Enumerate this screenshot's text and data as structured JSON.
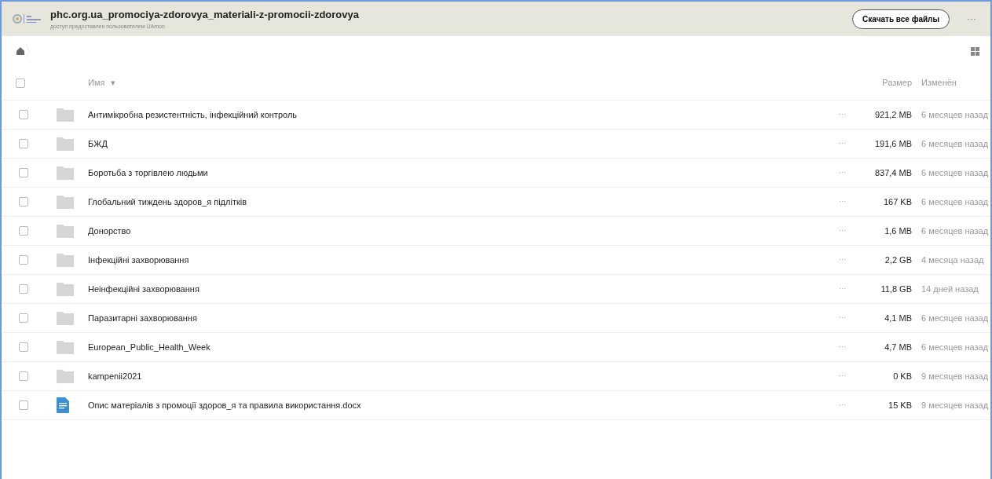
{
  "header": {
    "title": "phc.org.ua_promociya-zdorovya_materiali-z-promocii-zdorovya",
    "subtitle": "доступ предоставлен пользователем UAmon",
    "download_button": "Скачать все файлы",
    "menu": "···"
  },
  "columns": {
    "name": "Имя",
    "sort": "▾",
    "size": "Размер",
    "modified": "Изменён"
  },
  "select_all": {
    "checked": false
  },
  "rows": [
    {
      "kind": "folder",
      "name": "Антимікробна резистентність, інфекційний контроль",
      "size": "921,2 MB",
      "modified": "6 месяцев назад",
      "checked": false
    },
    {
      "kind": "folder",
      "name": "БЖД",
      "size": "191,6 MB",
      "modified": "6 месяцев назад",
      "checked": false
    },
    {
      "kind": "folder",
      "name": "Боротьба з торгівлею людьми",
      "size": "837,4 MB",
      "modified": "6 месяцев назад",
      "checked": false
    },
    {
      "kind": "folder",
      "name": "Глобальний тиждень здоров_я підлітків",
      "size": "167 KB",
      "modified": "6 месяцев назад",
      "checked": false
    },
    {
      "kind": "folder",
      "name": "Донорство",
      "size": "1,6 MB",
      "modified": "6 месяцев назад",
      "checked": false
    },
    {
      "kind": "folder",
      "name": "Інфекційні захворювання",
      "size": "2,2 GB",
      "modified": "4 месяца назад",
      "checked": false
    },
    {
      "kind": "folder",
      "name": "Неінфекційні захворювання",
      "size": "11,8 GB",
      "modified": "14 дней назад",
      "checked": false
    },
    {
      "kind": "folder",
      "name": "Паразитарні захворювання",
      "size": "4,1 MB",
      "modified": "6 месяцев назад",
      "checked": false
    },
    {
      "kind": "folder",
      "name": "European_Public_Health_Week",
      "size": "4,7 MB",
      "modified": "6 месяцев назад",
      "checked": false
    },
    {
      "kind": "folder",
      "name": "kampenii2021",
      "size": "0 KB",
      "modified": "9 месяцев назад",
      "checked": false
    },
    {
      "kind": "document",
      "name": "Опис матеріалів з промоції здоров_я та правила використання.docx",
      "size": "15 KB",
      "modified": "9 месяцев назад",
      "checked": false
    }
  ]
}
